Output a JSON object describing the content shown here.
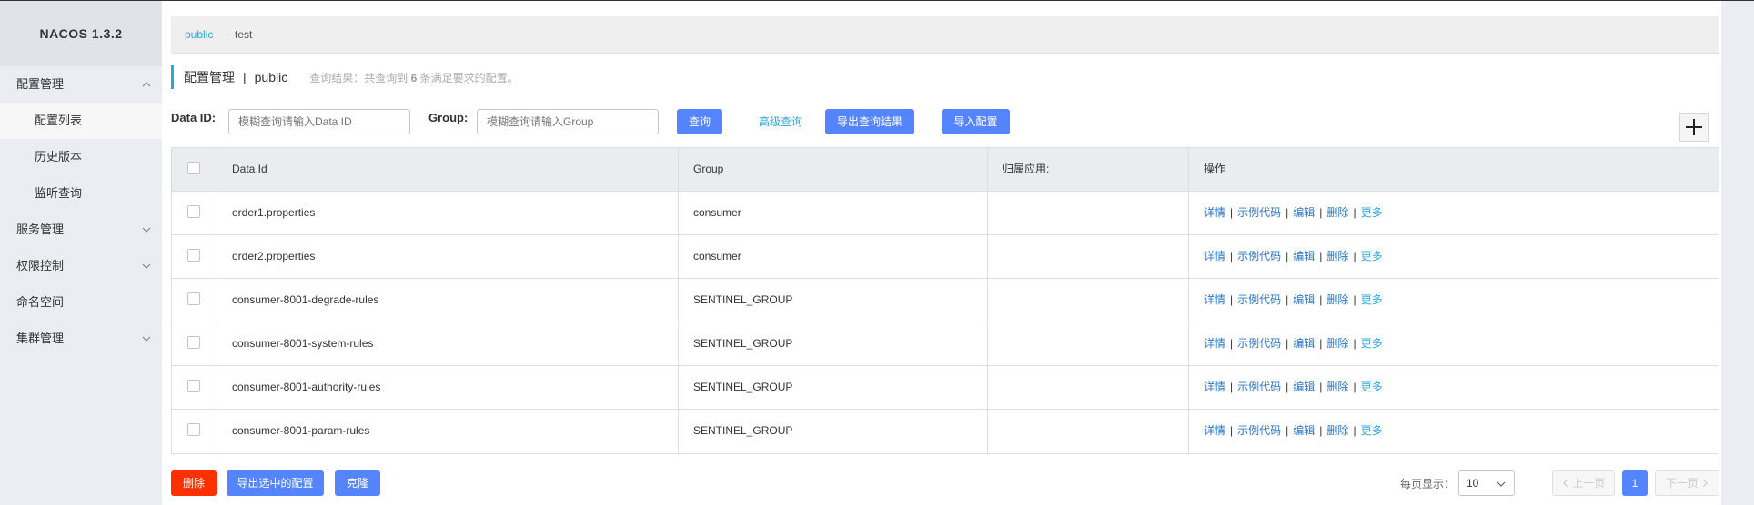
{
  "app": {
    "title": "NACOS 1.3.2"
  },
  "sidebar": {
    "items": [
      {
        "label": "配置管理",
        "expanded": true
      },
      {
        "label": "配置列表",
        "sub": true,
        "active": true
      },
      {
        "label": "历史版本",
        "sub": true
      },
      {
        "label": "监听查询",
        "sub": true
      },
      {
        "label": "服务管理",
        "expanded": false
      },
      {
        "label": "权限控制",
        "expanded": false
      },
      {
        "label": "命名空间"
      },
      {
        "label": "集群管理",
        "expanded": false
      }
    ]
  },
  "namespace": {
    "active": "public",
    "separator": "|",
    "other": "test"
  },
  "header": {
    "title": "配置管理",
    "pipe": "|",
    "namespace": "public",
    "result_prefix": "查询结果：共查询到",
    "result_count": "6",
    "result_suffix": "条满足要求的配置。"
  },
  "search": {
    "data_id_label": "Data ID:",
    "data_id_placeholder": "模糊查询请输入Data ID",
    "group_label": "Group:",
    "group_placeholder": "模糊查询请输入Group",
    "query_button": "查询",
    "advanced_link": "高级查询",
    "export_button": "导出查询结果",
    "import_button": "导入配置"
  },
  "table": {
    "headers": [
      "Data Id",
      "Group",
      "归属应用:",
      "操作"
    ],
    "rows": [
      {
        "data_id": "order1.properties",
        "group": "consumer",
        "app": ""
      },
      {
        "data_id": "order2.properties",
        "group": "consumer",
        "app": ""
      },
      {
        "data_id": "consumer-8001-degrade-rules",
        "group": "SENTINEL_GROUP",
        "app": ""
      },
      {
        "data_id": "consumer-8001-system-rules",
        "group": "SENTINEL_GROUP",
        "app": ""
      },
      {
        "data_id": "consumer-8001-authority-rules",
        "group": "SENTINEL_GROUP",
        "app": ""
      },
      {
        "data_id": "consumer-8001-param-rules",
        "group": "SENTINEL_GROUP",
        "app": ""
      }
    ],
    "actions": [
      "详情",
      "示例代码",
      "编辑",
      "删除",
      "更多"
    ],
    "action_separator": "|"
  },
  "footer": {
    "delete_button": "删除",
    "export_selected_button": "导出选中的配置",
    "clone_button": "克隆",
    "page_size_label": "每页显示：",
    "page_size": "10",
    "prev_label": "上一页",
    "current_page": "1",
    "next_label": "下一页"
  },
  "colors": {
    "primary": "#5584ff",
    "danger": "#ff3000",
    "link": "#2ba8d9",
    "action_link": "#2d79c7",
    "sidebar_bg": "#eaedf1"
  },
  "icons": [
    "chevron-up-icon",
    "chevron-down-icon",
    "plus-icon",
    "chevron-left-icon",
    "chevron-right-icon"
  ]
}
